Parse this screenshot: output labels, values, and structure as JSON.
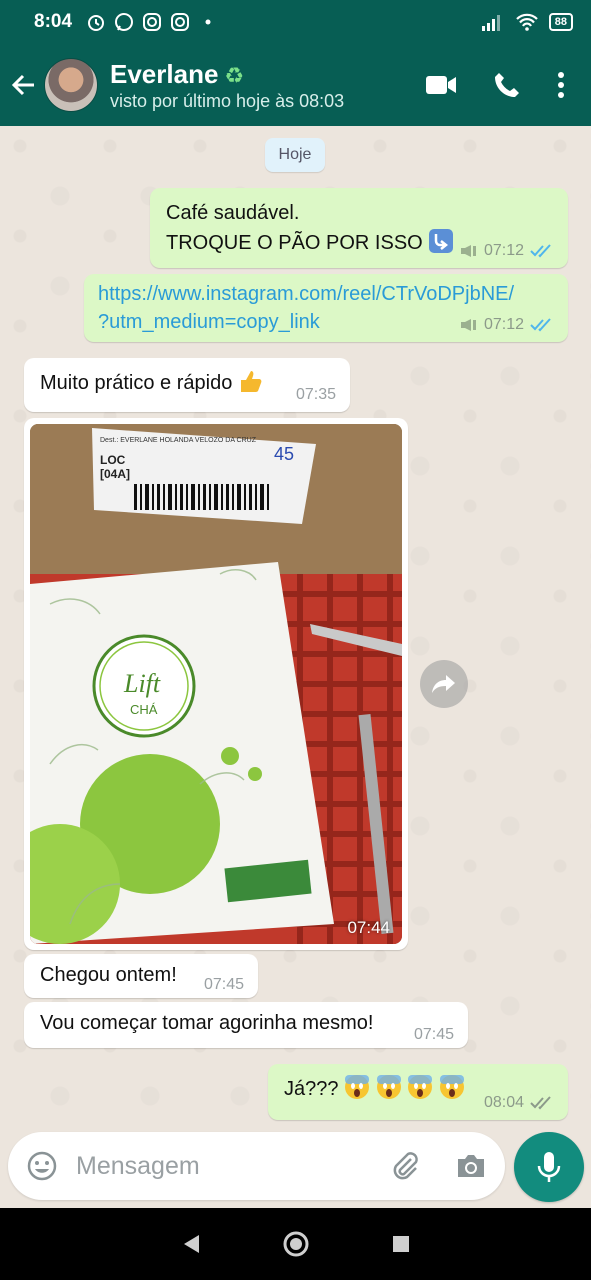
{
  "status_bar": {
    "time": "8:04",
    "battery": "88"
  },
  "header": {
    "contact_name": "Everlane",
    "name_emoji": "♻",
    "last_seen": "visto por último hoje às 08:03"
  },
  "date_chip": "Hoje",
  "messages": [
    {
      "dir": "out",
      "line1": "Café saudável.",
      "line2": "TROQUE O PÃO POR ISSO",
      "time": "07:12"
    },
    {
      "dir": "out",
      "line1": "https://www.instagram.com/reel/CTrVoDPjbNE/",
      "line2": "?utm_medium=copy_link",
      "time": "07:12"
    },
    {
      "dir": "in",
      "text": "Muito prático e rápido",
      "time": "07:35"
    },
    {
      "dir": "in",
      "type": "photo",
      "time": "07:44",
      "box_text": {
        "logo_line1": "Lift",
        "logo_line2": "CHÁ",
        "label_loc": "LOC",
        "label_code": "[04A]",
        "label_handwritten": "45"
      }
    },
    {
      "dir": "in",
      "text": "Chegou ontem!",
      "time": "07:45"
    },
    {
      "dir": "in",
      "text": "Vou começar tomar agorinha mesmo!",
      "time": "07:45"
    },
    {
      "dir": "out",
      "text": "Já???",
      "time": "08:04"
    }
  ],
  "input": {
    "placeholder": "Mensagem"
  },
  "colors": {
    "header": "#075e54",
    "outgoing": "#dcf8c6",
    "incoming": "#ffffff",
    "read_ticks": "#4fb6ec",
    "mic": "#128c7e"
  }
}
